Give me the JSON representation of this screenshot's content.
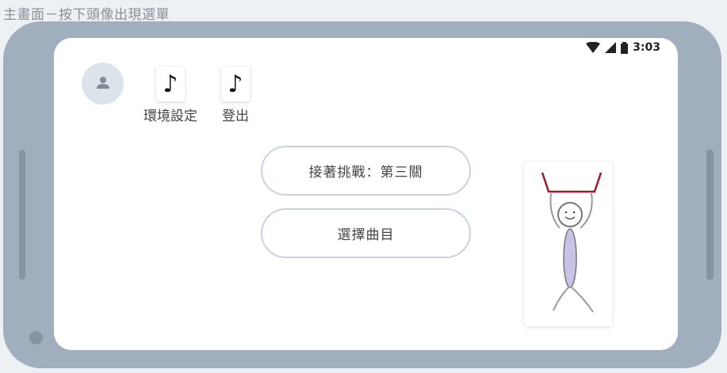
{
  "caption": "主畫面－按下頭像出現選單",
  "status_bar": {
    "time": "3:03",
    "icons": [
      "wifi-icon",
      "cell-signal-icon",
      "battery-icon"
    ]
  },
  "avatar": {
    "icon": "person-icon"
  },
  "menu": {
    "items": [
      {
        "icon": "music-note-icon",
        "glyph": "♪",
        "label": "環境設定"
      },
      {
        "icon": "music-note-icon",
        "glyph": "♪",
        "label": "登出"
      }
    ]
  },
  "buttons": {
    "continue_label": "接著挑戰：第三關",
    "select_song_label": "選擇曲目"
  },
  "character": {
    "icon": "stick-figure-icon"
  },
  "colors": {
    "phone_frame": "#a0aebd",
    "screen": "#ffffff",
    "button_border": "#c8d3de",
    "figure_arms": "#9b1b2a",
    "figure_body": "#c9c1e6"
  }
}
